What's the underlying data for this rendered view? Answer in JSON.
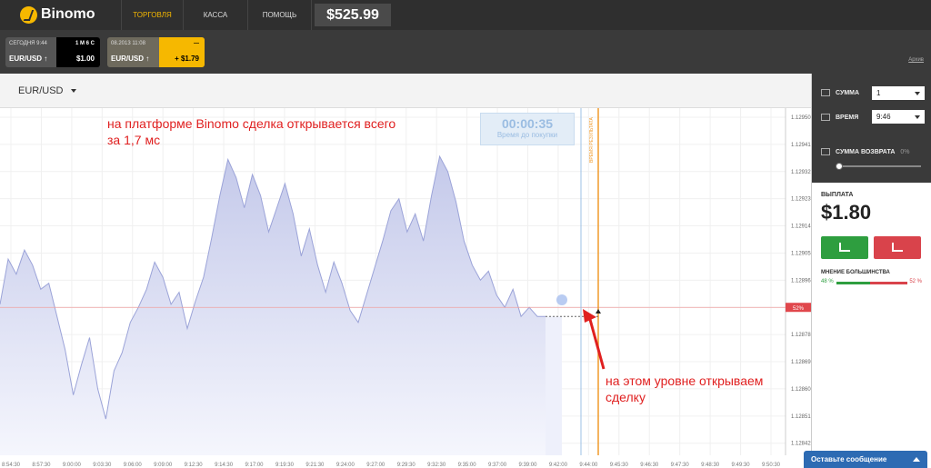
{
  "app": {
    "logo_text": "Binomo"
  },
  "nav": {
    "trade": "ТОРГОВЛЯ",
    "cash": "КАССА",
    "help": "ПОМОЩЬ"
  },
  "balance": "$525.99",
  "trades": [
    {
      "date": "СЕГОДНЯ 9:44",
      "term": "1 М 6 С",
      "pair": "EUR/USD ↑",
      "amount": "$1.00"
    },
    {
      "date": "08.2013 11:08",
      "term": "—",
      "pair": "EUR/USD ↑",
      "amount": "+ $1.79"
    }
  ],
  "archive_link": "Архив",
  "asset": {
    "selected": "EUR/USD"
  },
  "timer": {
    "value": "00:00:35",
    "label": "Время до покупки"
  },
  "annotations": {
    "top": "на платформе Binomo сделка открывается всего за 1,7 мс",
    "bottom": "на этом уровне открываем сделку"
  },
  "chart_data": {
    "type": "area",
    "x_labels": [
      "8:54:30",
      "8:57:30",
      "9:00:00",
      "9:03:30",
      "9:06:00",
      "9:09:00",
      "9:12:30",
      "9:14:30",
      "9:17:00",
      "9:19:30",
      "9:21:30",
      "9:24:00",
      "9:27:00",
      "9:29:30",
      "9:32:30",
      "9:35:00",
      "9:37:00",
      "9:39:00",
      "9:42:00",
      "9:44:00",
      "9:45:30",
      "9:46:30",
      "9:47:30",
      "9:48:30",
      "9:49:30",
      "9:50:30"
    ],
    "y_ticks": [
      "1.12950",
      "1.12941",
      "1.12932",
      "1.12923",
      "1.12914",
      "1.12905",
      "1.12896",
      "1.12887",
      "1.12878",
      "1.12869",
      "1.12860",
      "1.12851",
      "1.12842"
    ],
    "ylim": [
      1.12838,
      1.12953
    ],
    "current_value": 1.12887,
    "current_label": "52%",
    "purchase_label": "ВРЕМЯ РЕЗУЛЬТАТА",
    "series": [
      {
        "values": [
          1.12888,
          1.12903,
          1.12898,
          1.12906,
          1.12901,
          1.12893,
          1.12895,
          1.12884,
          1.12873,
          1.12858,
          1.12868,
          1.12877,
          1.1286,
          1.1285,
          1.12866,
          1.12872,
          1.12882,
          1.12887,
          1.12893,
          1.12902,
          1.12897,
          1.12888,
          1.12892,
          1.1288,
          1.12889,
          1.12897,
          1.1291,
          1.12924,
          1.12936,
          1.1293,
          1.1292,
          1.12931,
          1.12924,
          1.12912,
          1.1292,
          1.12928,
          1.12918,
          1.12904,
          1.12913,
          1.12901,
          1.12892,
          1.12902,
          1.12895,
          1.12886,
          1.12882,
          1.12891,
          1.129,
          1.12909,
          1.12919,
          1.12923,
          1.12912,
          1.12918,
          1.12909,
          1.12924,
          1.12937,
          1.12932,
          1.12922,
          1.12909,
          1.12901,
          1.12896,
          1.12899,
          1.12891,
          1.12887,
          1.12893,
          1.12884,
          1.12887,
          1.12884,
          1.12884
        ]
      }
    ]
  },
  "panel": {
    "amount_label": "СУММА",
    "amount_value": "1",
    "time_label": "ВРЕМЯ",
    "time_value": "9:46",
    "return_label": "СУММА ВОЗВРАТА",
    "return_value": "0%",
    "payout_label": "ВЫПЛАТА",
    "payout_value": "$1.80",
    "majority_label": "МНЕНИЕ БОЛЬШИНСТВА",
    "majority_up": "48 %",
    "majority_down": "52 %",
    "majority_up_fraction": 0.48
  },
  "chat": {
    "label": "Оставьте сообщение"
  }
}
